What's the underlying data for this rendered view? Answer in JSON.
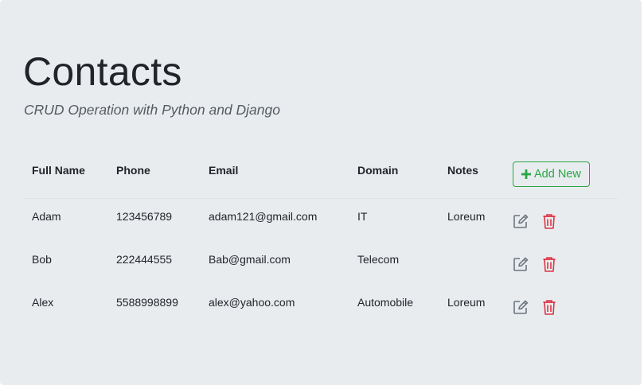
{
  "header": {
    "title": "Contacts",
    "subtitle": "CRUD Operation with Python and Django"
  },
  "table": {
    "columns": [
      "Full Name",
      "Phone",
      "Email",
      "Domain",
      "Notes"
    ],
    "add_button_label": "Add New",
    "rows": [
      {
        "full_name": "Adam",
        "phone": "123456789",
        "email": "adam121@gmail.com",
        "domain": "IT",
        "notes": "Loreum"
      },
      {
        "full_name": "Bob",
        "phone": "222444555",
        "email": "Bab@gmail.com",
        "domain": "Telecom",
        "notes": ""
      },
      {
        "full_name": "Alex",
        "phone": "5588998899",
        "email": "alex@yahoo.com",
        "domain": "Automobile",
        "notes": "Loreum"
      }
    ]
  },
  "icons": {
    "add": "plus-icon",
    "edit": "edit-icon",
    "delete": "trash-icon"
  },
  "colors": {
    "background": "#e9ecef",
    "add_accent": "#28a745",
    "edit": "#6c757d",
    "delete": "#dc3545",
    "text": "#212529"
  }
}
